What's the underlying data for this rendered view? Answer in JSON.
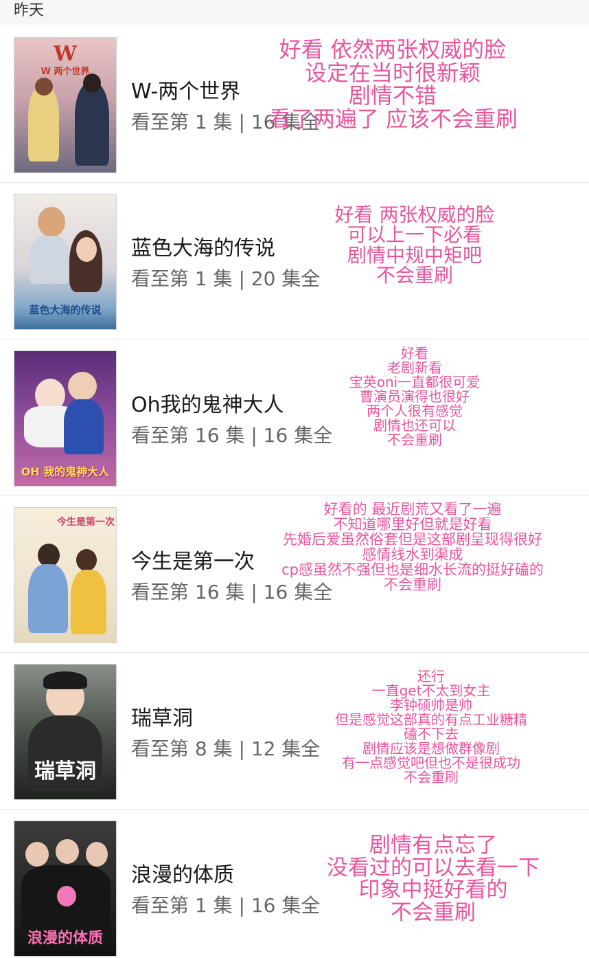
{
  "section": {
    "date_label": "昨天"
  },
  "colors": {
    "annotation": "#e8559e",
    "title": "#1a1a1a",
    "subtitle": "#666666",
    "divider": "#e6e6e6"
  },
  "items": [
    {
      "title": "W-两个世界",
      "progress": "看至第 1 集 | 16 集全",
      "poster_text": "W 两个世界",
      "note": [
        "好看 依然两张权威的脸",
        "设定在当时很新颖",
        "剧情不错",
        "看了两遍了 应该不会重刷"
      ]
    },
    {
      "title": "蓝色大海的传说",
      "progress": "看至第 1 集 | 20 集全",
      "poster_text": "蓝色大海的传说",
      "note": [
        "好看 两张权威的脸",
        "可以上一下必看",
        "剧情中规中矩吧",
        "不会重刷"
      ]
    },
    {
      "title": "Oh我的鬼神大人",
      "progress": "看至第 16 集 | 16 集全",
      "poster_text": "OH 我的鬼神大人",
      "note": [
        "好看",
        "老剧新看",
        "宝英oni一直都很可爱",
        "曹演员演得也很好",
        "两个人很有感觉",
        "剧情也还可以",
        "不会重刷"
      ]
    },
    {
      "title": "今生是第一次",
      "progress": "看至第 16 集 | 16 集全",
      "poster_text": "今生是第一次",
      "note": [
        "好看的 最近剧荒又看了一遍",
        "不知道哪里好但就是好看",
        "先婚后爱虽然俗套但是这部剧呈现得很好",
        "感情线水到渠成",
        "cp感虽然不强但也是细水长流的挺好磕的",
        "不会重刷"
      ]
    },
    {
      "title": "瑞草洞",
      "progress": "看至第 8 集 | 12 集全",
      "poster_text": "瑞草洞",
      "note": [
        "还行",
        "一直get不太到女主",
        "李钟硕帅是帅",
        "但是感觉这部真的有点工业糖精",
        "磕不下去",
        "剧情应该是想做群像剧",
        "有一点感觉吧但也不是很成功",
        "不会重刷"
      ]
    },
    {
      "title": "浪漫的体质",
      "progress": "看至第 1 集 | 16 集全",
      "poster_text": "浪漫的体质",
      "note": [
        "剧情有点忘了",
        "没看过的可以去看一下",
        "印象中挺好看的",
        "不会重刷"
      ]
    }
  ]
}
